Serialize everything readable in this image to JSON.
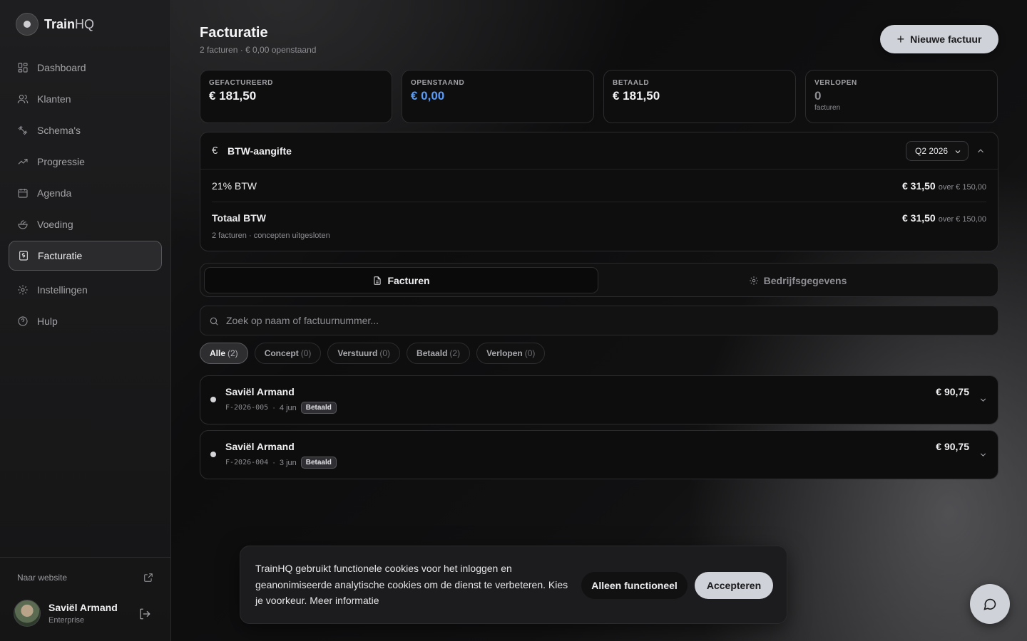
{
  "brand": {
    "name_a": "Train",
    "name_b": "HQ"
  },
  "sidebar": {
    "items": [
      {
        "label": "Dashboard",
        "icon": "dashboard-icon"
      },
      {
        "label": "Klanten",
        "icon": "users-icon"
      },
      {
        "label": "Schema's",
        "icon": "dumbbell-icon"
      },
      {
        "label": "Progressie",
        "icon": "trending-up-icon"
      },
      {
        "label": "Agenda",
        "icon": "calendar-icon"
      },
      {
        "label": "Voeding",
        "icon": "salad-icon"
      },
      {
        "label": "Facturatie",
        "icon": "receipt-icon",
        "active": true
      },
      {
        "label": "Instellingen",
        "icon": "gear-icon"
      },
      {
        "label": "Hulp",
        "icon": "help-icon"
      }
    ],
    "website_link": "Naar website",
    "user": {
      "name": "Saviël Armand",
      "plan": "Enterprise"
    }
  },
  "header": {
    "title": "Facturatie",
    "subtitle": "2 facturen · € 0,00 openstaand",
    "new_button": "Nieuwe factuur"
  },
  "stats": [
    {
      "label": "GEFACTUREERD",
      "value": "€ 181,50"
    },
    {
      "label": "OPENSTAAND",
      "value": "€ 0,00",
      "color": "#5a9cf5"
    },
    {
      "label": "BETAALD",
      "value": "€ 181,50"
    },
    {
      "label": "VERLOPEN",
      "value": "0",
      "note": "facturen"
    }
  ],
  "btw": {
    "icon": "€",
    "title": "BTW-aangifte",
    "quarter": "Q2 2026",
    "rows": [
      {
        "label": "21% BTW",
        "amount": "€ 31,50",
        "over": "over € 150,00"
      },
      {
        "label": "Totaal BTW",
        "amount": "€ 31,50",
        "over": "over € 150,00"
      }
    ],
    "note": "2 facturen · concepten uitgesloten"
  },
  "tabs": [
    {
      "label": "Facturen",
      "icon": "document-icon",
      "active": true
    },
    {
      "label": "Bedrijfsgegevens",
      "icon": "gear-icon"
    }
  ],
  "search": {
    "placeholder": "Zoek op naam of factuurnummer..."
  },
  "filters": [
    {
      "label": "Alle",
      "count": "(2)",
      "active": true
    },
    {
      "label": "Concept",
      "count": "(0)"
    },
    {
      "label": "Verstuurd",
      "count": "(0)"
    },
    {
      "label": "Betaald",
      "count": "(2)"
    },
    {
      "label": "Verlopen",
      "count": "(0)"
    }
  ],
  "invoices": [
    {
      "name": "Saviël Armand",
      "number": "F-2026-005",
      "date": "4 jun",
      "status": "Betaald",
      "amount": "€ 90,75"
    },
    {
      "name": "Saviël Armand",
      "number": "F-2026-004",
      "date": "3 jun",
      "status": "Betaald",
      "amount": "€ 90,75"
    }
  ],
  "cookie": {
    "text": "TrainHQ gebruikt functionele cookies voor het inloggen en geanonimiseerde analytische cookies om de dienst te verbeteren. Kies je voorkeur.",
    "more": "Meer informatie",
    "functional_button": "Alleen functioneel",
    "accept_button": "Accepteren"
  },
  "colors": {
    "accent": "#cfd2d9",
    "blue": "#5a9cf5",
    "background": "#0b0b0c"
  }
}
